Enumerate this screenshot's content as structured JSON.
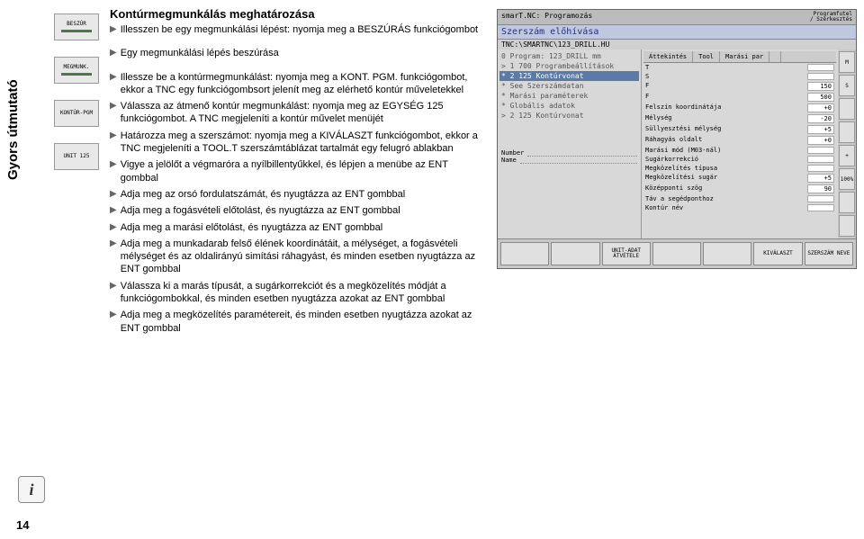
{
  "sidebar": {
    "label": "Gyors útmutató"
  },
  "info_icon": "i",
  "page_number": "14",
  "icons": {
    "beszur": "BESZÚR",
    "megmunk": "MEGMUNK.",
    "kontur_pgm": "KONTÚR-PGM",
    "unit_125": "UNIT 125"
  },
  "section": {
    "title": "Kontúrmegmunkálás meghatározása",
    "group1": [
      "Illesszen be egy megmunkálási lépést: nyomja meg a BESZÚRÁS funkciógombot",
      "Egy megmunkálási lépés beszúrása"
    ],
    "group2": [
      "Illessze be a kontúrmegmunkálást: nyomja meg a KONT. PGM. funkciógombot, ekkor a TNC egy funkciógombsort jelenít meg az elérhető kontúr műveletekkel",
      "Válassza az átmenő kontúr megmunkálást: nyomja meg az EGYSÉG 125 funkciógombot. A TNC megjeleníti a kontúr művelet menüjét",
      "Határozza meg a szerszámot: nyomja meg a KIVÁLASZT funkciógombot, ekkor a TNC megjeleníti a TOOL.T szerszámtáblázat tartalmát egy felugró ablakban",
      "Vigye a jelölőt a végmaróra a nyílbillentyűkkel, és lépjen a menübe az ENT gombbal",
      "Adja meg az orsó fordulatszámát, és nyugtázza az ENT gombbal",
      "Adja meg a fogásvételi előtolást, és nyugtázza az ENT gombbal",
      "Adja meg a marási előtolást, és nyugtázza az ENT gombbal",
      "Adja meg a munkadarab felső élének koordinátáit, a mélységet, a fogásvételi mélységet és az oldalirányú simítási ráhagyást, és minden esetben nyugtázza az ENT gombbal",
      "Válassza ki a marás típusát, a sugárkorrekciót és a megközelítés módját a funkciógombokkal, és minden esetben nyugtázza azokat az ENT gombbal",
      "Adja meg a megközelítés paramétereit, és minden esetben nyugtázza azokat az ENT gombbal"
    ]
  },
  "cnc": {
    "title_left": "smarT.NC: Programozás",
    "title_right_1": "Programfutel",
    "title_right_2": "/ Szerkesztés",
    "subtitle": "Szerszám előhívása",
    "path": "TNC:\\SMARTNC\\123_DRILL.HU",
    "tabs": [
      "Áttekintés",
      "Tool",
      "Marási par",
      ""
    ],
    "left_lines": [
      "0 Program: 123_DRILL mm",
      "> 1   700 Programbeállítások",
      "* 2   125 Kontúrvonat",
      "    *   See Szerszámdatan",
      "    *   Marási paraméterek",
      "    *   Globális adatok",
      "> 2   125 Kontúrvonat"
    ],
    "params": [
      {
        "k": "T",
        "v": ""
      },
      {
        "k": "S",
        "v": ""
      },
      {
        "k": "F",
        "v": "150"
      },
      {
        "k": "F",
        "v": "500"
      },
      {
        "k": "Felszín koordinátája",
        "v": "+0"
      },
      {
        "k": "Mélység",
        "v": "-20"
      },
      {
        "k": "Süllyesztési mélység",
        "v": "+5"
      },
      {
        "k": "Ráhagyás oldalt",
        "v": "+0"
      },
      {
        "k": "Marási mód (M03-nál)",
        "v": ""
      },
      {
        "k": "Sugárkorrekció",
        "v": ""
      },
      {
        "k": "Megközelítés típusa",
        "v": ""
      },
      {
        "k": "Megközelítési sugár",
        "v": "+5"
      },
      {
        "k": "Középponti szög",
        "v": "90"
      },
      {
        "k": "Táv a segédponthoz",
        "v": ""
      },
      {
        "k": "Kontúr név",
        "v": ""
      }
    ],
    "number_label": "Number",
    "name_label": "Name",
    "right_btns": [
      "M",
      "S",
      "",
      "",
      "+",
      "100%",
      "",
      ""
    ],
    "softkeys": [
      "",
      "",
      "UNIT-ADAT ÁTVÉTELE",
      "",
      "",
      "KIVÁLASZT",
      "SZERSZÁM NEVE"
    ]
  }
}
